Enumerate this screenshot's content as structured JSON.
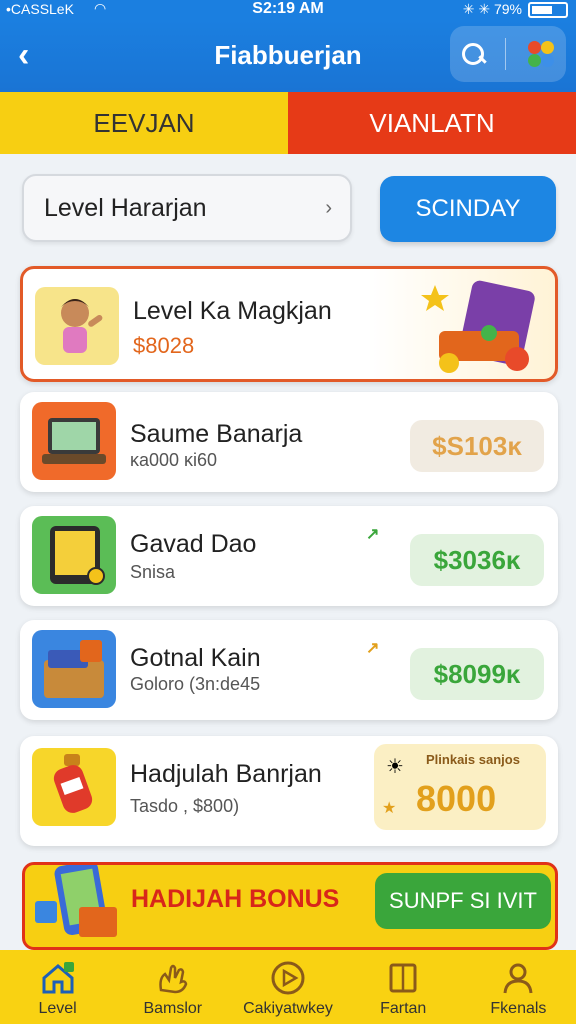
{
  "status_bar": {
    "carrier": "•CASSLeK",
    "time": "S2:19 AM",
    "battery": "✳ ✳ 79%"
  },
  "header": {
    "title": "Fiabbuerjan"
  },
  "tabs": [
    {
      "label": "EEVJAN"
    },
    {
      "label": "VIANLATN"
    }
  ],
  "filter": {
    "label": "Level Hararjan",
    "action_label": "SCINDAY"
  },
  "items": [
    {
      "title": "Level Ka Magkjan",
      "price": "$8028",
      "featured": true
    },
    {
      "title": "Saume Banarja",
      "subtitle": "ĸa000 ĸi60",
      "price": "$S103ĸ"
    },
    {
      "title": "Gavad Dao",
      "subtitle": "Snisa",
      "price": "$3036ĸ"
    },
    {
      "title": "Gotnal Kain",
      "subtitle": "Goloro (3n:de45",
      "price": "$8099ĸ"
    },
    {
      "title": "Hadjulah Banrjan",
      "subtitle": "Tasdo , $800)",
      "promo_title": "Plinkais sanjos",
      "promo_value": "8000"
    }
  ],
  "bonus": {
    "title": "HADIJAH BONUS",
    "button": "SUNPF SI IVIT"
  },
  "nav": [
    {
      "label": "Level",
      "icon": "home-icon"
    },
    {
      "label": "Bamslor",
      "icon": "hand-icon"
    },
    {
      "label": "Cakiyatwkey",
      "icon": "play-icon"
    },
    {
      "label": "Fartan",
      "icon": "book-icon"
    },
    {
      "label": "Fkenals",
      "icon": "profile-icon"
    }
  ],
  "colors": {
    "primary_blue": "#1b7fe0",
    "yellow": "#f7cf12",
    "red": "#e63a17",
    "green": "#3aa63b",
    "orange": "#e2661c"
  }
}
